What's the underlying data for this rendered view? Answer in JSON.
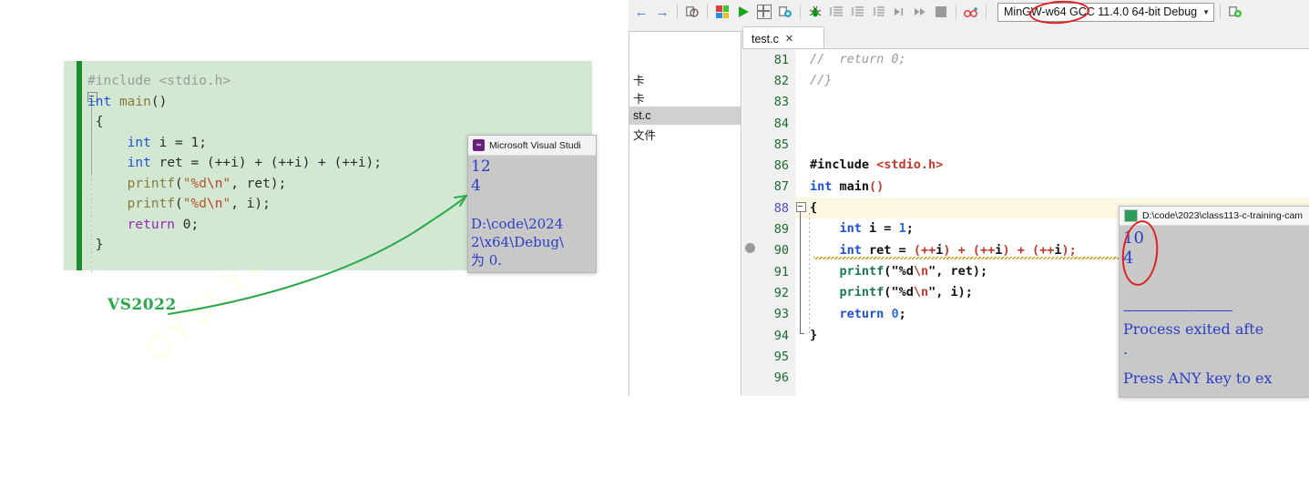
{
  "watermark": {
    "text": "CYSLYLY"
  },
  "vs_shot": {
    "label": "VS2022",
    "code_lines": [
      "#include <stdio.h>",
      "int main()",
      "{",
      "    int i = 1;",
      "    int ret = (++i) + (++i) + (++i);",
      "    printf(\"%d\\n\", ret);",
      "    printf(\"%d\\n\", i);",
      "    return 0;",
      "}"
    ],
    "console": {
      "title": "Microsoft Visual Studi",
      "icon": "visual-studio-icon",
      "output_lines": [
        "12",
        "4",
        "",
        "D:\\code\\2024",
        "2\\x64\\Debug\\",
        "为 0."
      ]
    }
  },
  "ide": {
    "toolbar": {
      "back_icon": "arrow-left-icon",
      "forward_icon": "arrow-right-icon",
      "inspect_icon": "inspect-icon",
      "compile_icon": "compile-grid-icon",
      "run_icon": "run-play-icon",
      "compile_run_icon": "compile-run-icon",
      "rebuild_icon": "rebuild-icon",
      "debug_icon": "debug-bug-icon",
      "indent1_icon": "indent-icon",
      "indent2_icon": "outdent-icon",
      "indent3_icon": "format-icon",
      "step_into_icon": "step-into-icon",
      "step_over_icon": "step-over-icon",
      "stop_icon": "stop-square-icon",
      "watch_icon": "watch-glasses-icon",
      "profile_icon": "profile-icon",
      "compiler": "MinGW-w64 GCC 11.4.0 64-bit Debug",
      "caret": "▼"
    },
    "tab": {
      "label": "test.c",
      "close": "✕"
    },
    "tree_items": [
      "卡",
      "卡",
      "st.c",
      "文件"
    ],
    "tree_selected_index": 2,
    "line_numbers": [
      81,
      82,
      83,
      84,
      85,
      86,
      87,
      88,
      89,
      90,
      91,
      92,
      93,
      94,
      95,
      96
    ],
    "current_line": 88,
    "breakpoint_line": 90,
    "code_lines": [
      "//  return 0;",
      "//}",
      "",
      "",
      "",
      "#include <stdio.h>",
      "int main()",
      "{",
      "    int i = 1;",
      "    int ret = (++i) + (++i) + (++i);",
      "    printf(\"%d\\n\", ret);",
      "    printf(\"%d\\n\", i);",
      "    return 0;",
      "}",
      "",
      ""
    ],
    "console": {
      "title": "D:\\code\\2023\\class113-c-training-cam",
      "icon": "console-window-icon",
      "output_lines": [
        "10",
        "4",
        "",
        "--------------------------------",
        "Process exited afte",
        ".",
        "",
        "Press ANY key to ex"
      ]
    }
  },
  "annotations": {
    "vs_label_color": "#2aa84a",
    "red_ellipse_color": "#e02020",
    "circled_compiler_part": "GCC 1",
    "circled_output": "10 / 4"
  }
}
